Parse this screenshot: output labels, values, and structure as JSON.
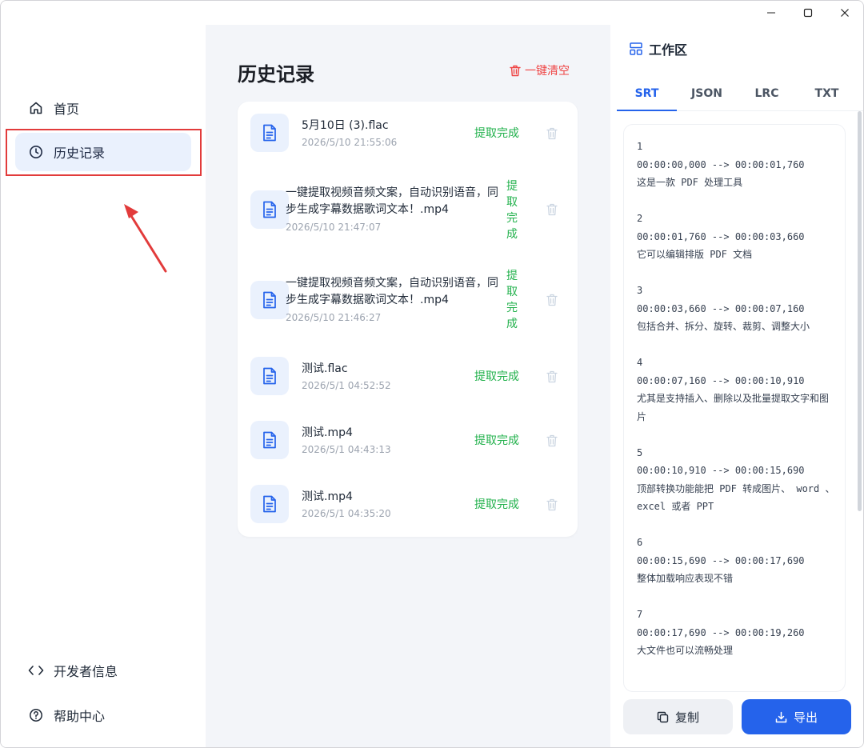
{
  "window_controls": {
    "minimize": "—",
    "maximize": "□",
    "close": "✕"
  },
  "sidebar": {
    "items": [
      {
        "label": "首页",
        "icon": "home-icon"
      },
      {
        "label": "历史记录",
        "icon": "clock-icon",
        "active": true
      },
      {
        "label": "开发者信息",
        "icon": "code-icon"
      },
      {
        "label": "帮助中心",
        "icon": "help-circle-icon"
      }
    ]
  },
  "history": {
    "title": "历史记录",
    "clear_label": "一键清空",
    "items": [
      {
        "name": "5月10日 (3).flac",
        "time": "2026/5/10 21:55:06",
        "status": "提取完成"
      },
      {
        "name": "一键提取视频音频文案，自动识别语音，同步生成字幕数据歌词文本！.mp4",
        "time": "2026/5/10 21:47:07",
        "status": "提取完成"
      },
      {
        "name": "一键提取视频音频文案，自动识别语音，同步生成字幕数据歌词文本！.mp4",
        "time": "2026/5/10 21:46:27",
        "status": "提取完成"
      },
      {
        "name": "测试.flac",
        "time": "2026/5/1 04:52:52",
        "status": "提取完成"
      },
      {
        "name": "测试.mp4",
        "time": "2026/5/1 04:43:13",
        "status": "提取完成"
      },
      {
        "name": "测试.mp4",
        "time": "2026/5/1 04:35:20",
        "status": "提取完成"
      }
    ]
  },
  "workspace": {
    "title": "工作区",
    "tabs": [
      "SRT",
      "JSON",
      "LRC",
      "TXT"
    ],
    "active_tab": "SRT",
    "content": "1\n00:00:00,000 --> 00:00:01,760\n这是一款 PDF 处理工具\n\n2\n00:00:01,760 --> 00:00:03,660\n它可以编辑排版 PDF 文档\n\n3\n00:00:03,660 --> 00:00:07,160\n包括合并、拆分、旋转、裁剪、调整大小\n\n4\n00:00:07,160 --> 00:00:10,910\n尤其是支持插入、删除以及批量提取文字和图片\n\n5\n00:00:10,910 --> 00:00:15,690\n顶部转换功能能把 PDF 转成图片、 word 、 excel 或者 PPT\n\n6\n00:00:15,690 --> 00:00:17,690\n整体加载响应表现不错\n\n7\n00:00:17,690 --> 00:00:19,260\n大文件也可以流畅处理",
    "copy_label": "复制",
    "export_label": "导出"
  },
  "colors": {
    "accent": "#2563eb",
    "success": "#22b14c",
    "danger": "#ef4444",
    "annotation": "#e23b3b"
  }
}
